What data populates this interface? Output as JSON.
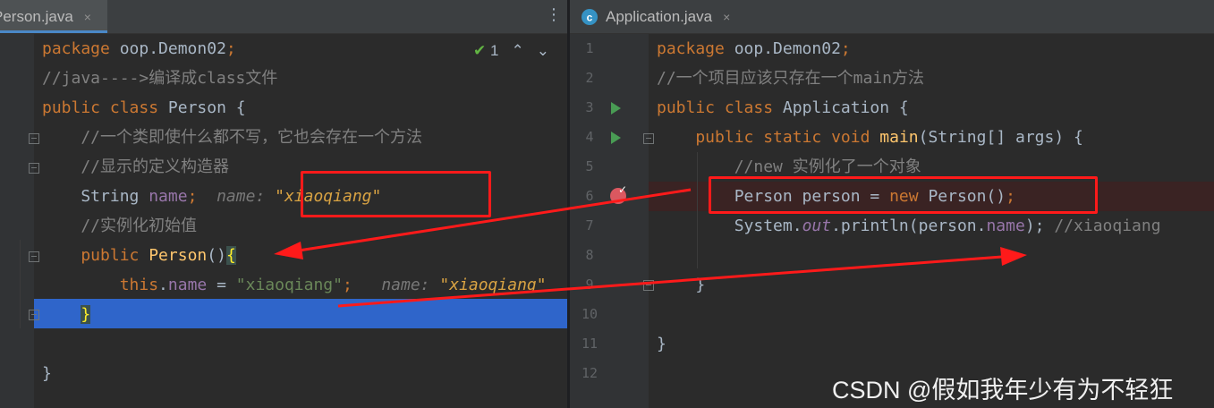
{
  "left_editor": {
    "tab": {
      "label": "Person.java",
      "close": "×"
    },
    "menu_glyph": "⋮",
    "inspection": {
      "count": "1",
      "up": "⌃",
      "down": "⌄"
    },
    "lines": [
      {
        "parts": [
          {
            "t": "package ",
            "c": "kw"
          },
          {
            "t": "oop.Demon02",
            "c": ""
          },
          {
            "t": ";",
            "c": "kw"
          }
        ]
      },
      {
        "parts": [
          {
            "t": "//java---->编译成class文件",
            "c": "cm"
          }
        ]
      },
      {
        "parts": [
          {
            "t": "public ",
            "c": "kw"
          },
          {
            "t": "class ",
            "c": "kw"
          },
          {
            "t": "Person {",
            "c": ""
          }
        ]
      },
      {
        "parts": [
          {
            "t": "    //一个类即使什么都不写，它也会存在一个方法",
            "c": "cm"
          }
        ]
      },
      {
        "parts": [
          {
            "t": "    //显示的定义构造器",
            "c": "cm"
          }
        ]
      },
      {
        "parts": [
          {
            "t": "    String ",
            "c": ""
          },
          {
            "t": "name",
            "c": "fld"
          },
          {
            "t": ";",
            "c": "kw"
          },
          {
            "t": "  name: ",
            "c": "inlay"
          },
          {
            "t": "\"xiaoqiang\"",
            "c": "inlay-val"
          }
        ]
      },
      {
        "parts": [
          {
            "t": "    //实例化初始值",
            "c": "cm"
          }
        ]
      },
      {
        "parts": [
          {
            "t": "    public ",
            "c": "kw"
          },
          {
            "t": "Person",
            "c": "fn"
          },
          {
            "t": "()",
            "c": ""
          },
          {
            "t": "{",
            "c": "brace-hl"
          }
        ]
      },
      {
        "parts": [
          {
            "t": "        this",
            "c": "kw"
          },
          {
            "t": ".",
            "c": ""
          },
          {
            "t": "name",
            "c": "fld"
          },
          {
            "t": " = ",
            "c": ""
          },
          {
            "t": "\"xiaoqiang\"",
            "c": "str"
          },
          {
            "t": ";",
            "c": "kw"
          },
          {
            "t": "   name: ",
            "c": "inlay"
          },
          {
            "t": "\"xiaoqiang\"",
            "c": "inlay-val"
          }
        ]
      },
      {
        "parts": [
          {
            "t": "    ",
            "c": ""
          },
          {
            "t": "}",
            "c": "brace-hl"
          }
        ]
      },
      {
        "parts": [
          {
            "t": "",
            "c": ""
          }
        ]
      },
      {
        "parts": [
          {
            "t": "}",
            "c": ""
          }
        ]
      }
    ]
  },
  "right_editor": {
    "tab": {
      "label": "Application.java",
      "close": "×",
      "icon": "c-class-icon"
    },
    "line_numbers": [
      "1",
      "2",
      "3",
      "4",
      "5",
      "6",
      "7",
      "8",
      "9",
      "10",
      "11",
      "12"
    ],
    "lines": [
      {
        "parts": [
          {
            "t": "package ",
            "c": "kw"
          },
          {
            "t": "oop.Demon02",
            "c": ""
          },
          {
            "t": ";",
            "c": "kw"
          }
        ]
      },
      {
        "parts": [
          {
            "t": "//一个项目应该只存在一个main方法",
            "c": "cm"
          }
        ]
      },
      {
        "parts": [
          {
            "t": "public ",
            "c": "kw"
          },
          {
            "t": "class ",
            "c": "kw"
          },
          {
            "t": "Application {",
            "c": ""
          }
        ]
      },
      {
        "parts": [
          {
            "t": "    public ",
            "c": "kw"
          },
          {
            "t": "static ",
            "c": "kw"
          },
          {
            "t": "void ",
            "c": "kw"
          },
          {
            "t": "main",
            "c": "fn"
          },
          {
            "t": "(String[] args) {",
            "c": ""
          }
        ]
      },
      {
        "parts": [
          {
            "t": "        //new 实例化了一个对象",
            "c": "cm"
          }
        ]
      },
      {
        "parts": [
          {
            "t": "        Person person = ",
            "c": ""
          },
          {
            "t": "new ",
            "c": "kw"
          },
          {
            "t": "Person()",
            "c": ""
          },
          {
            "t": ";",
            "c": "kw"
          }
        ]
      },
      {
        "parts": [
          {
            "t": "        System.",
            "c": ""
          },
          {
            "t": "out",
            "c": "fldi"
          },
          {
            "t": ".println(person.",
            "c": ""
          },
          {
            "t": "name",
            "c": "fld"
          },
          {
            "t": "); ",
            "c": ""
          },
          {
            "t": "//xiaoqiang",
            "c": "cm"
          }
        ]
      },
      {
        "parts": [
          {
            "t": "",
            "c": ""
          }
        ]
      },
      {
        "parts": [
          {
            "t": "    }",
            "c": ""
          }
        ]
      },
      {
        "parts": [
          {
            "t": "",
            "c": ""
          }
        ]
      },
      {
        "parts": [
          {
            "t": "}",
            "c": ""
          }
        ]
      },
      {
        "parts": [
          {
            "t": "",
            "c": ""
          }
        ]
      }
    ]
  },
  "watermark": "CSDN @假如我年少有为不轻狂",
  "colors": {
    "annotation": "#ff1a1a",
    "selection": "#2f65ca",
    "breakpoint": "#db5860",
    "run": "#499c54"
  }
}
